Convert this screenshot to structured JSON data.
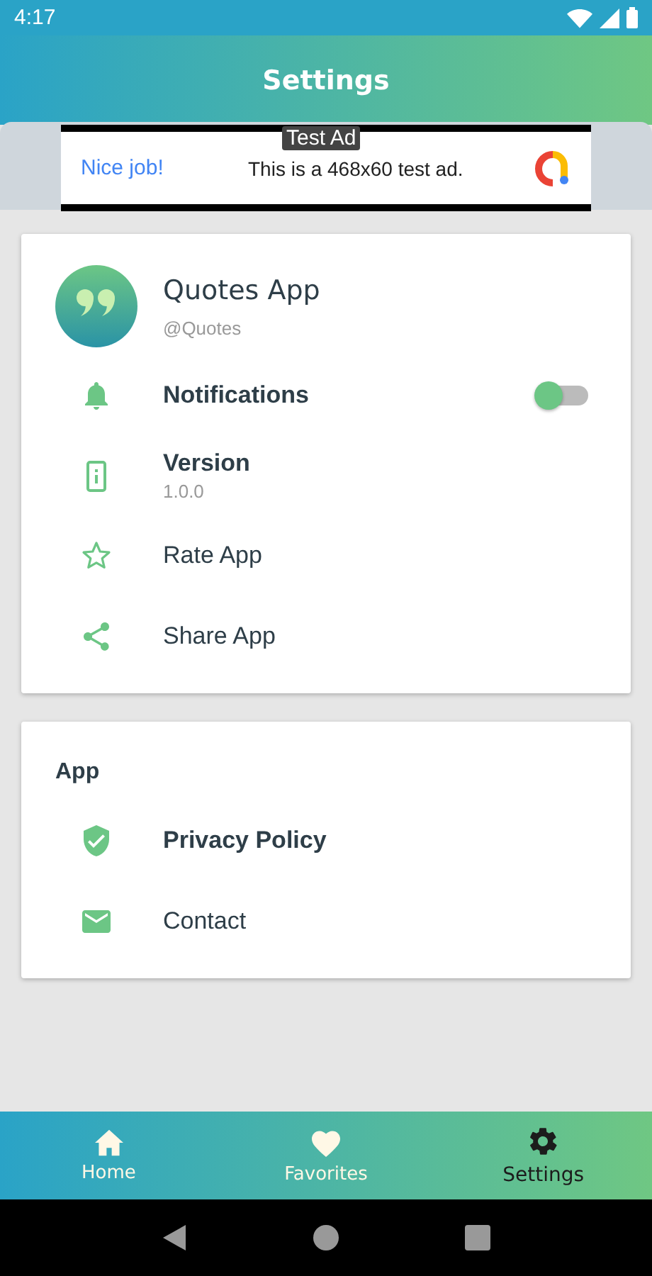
{
  "status_bar": {
    "time": "4:17"
  },
  "header": {
    "title": "Settings"
  },
  "ad": {
    "badge": "Test Ad",
    "headline": "Nice job!",
    "text": "This is a 468x60 test ad."
  },
  "profile": {
    "name": "Quotes App",
    "handle": "@Quotes"
  },
  "general_items": [
    {
      "kind": "toggle",
      "label": "Notifications",
      "emphasized": true,
      "on": false
    },
    {
      "kind": "detail",
      "label": "Version",
      "detail": "1.0.0",
      "emphasized": true
    },
    {
      "kind": "plain",
      "label": "Rate App",
      "emphasized": false
    },
    {
      "kind": "plain",
      "label": "Share App",
      "emphasized": false
    }
  ],
  "app_section": {
    "title": "App",
    "items": [
      {
        "kind": "plain",
        "label": "Privacy Policy",
        "emphasized": true
      },
      {
        "kind": "plain",
        "label": "Contact",
        "emphasized": false
      }
    ]
  },
  "bottom_nav": [
    {
      "label": "Home",
      "selected": false
    },
    {
      "label": "Favorites",
      "selected": false
    },
    {
      "label": "Settings",
      "selected": true
    }
  ]
}
